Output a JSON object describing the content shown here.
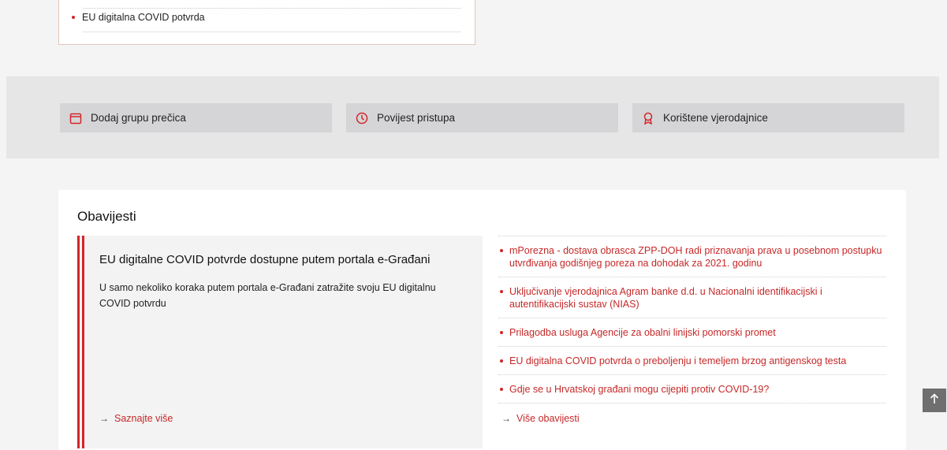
{
  "top_card": {
    "item": "EU digitalna COVID potvrda"
  },
  "quick_links": [
    {
      "label": "Dodaj grupu prečica",
      "icon": "calendar-icon"
    },
    {
      "label": "Povijest pristupa",
      "icon": "clock-icon"
    },
    {
      "label": "Korištene vjerodajnice",
      "icon": "award-icon"
    }
  ],
  "notices": {
    "title": "Obavijesti",
    "featured": {
      "headline": "EU digitalne COVID potvrde dostupne putem portala e-Građani",
      "body": "U samo nekoliko koraka putem portala e-Građani zatražite svoju EU digitalnu COVID potvrdu",
      "link": "Saznajte više"
    },
    "items": [
      "mPorezna - dostava obrasca ZPP-DOH radi priznavanja prava u posebnom postupku utvrđivanja godišnjeg poreza na dohodak za 2021. godinu",
      "Uključivanje vjerodajnica Agram banke d.d. u Nacionalni identifikacijski i autentifikacijski sustav (NIAS)",
      "Prilagodba usluga Agencije za obalni linijski pomorski promet",
      "EU digitalna COVID potvrda o preboljenju i temeljem brzog antigenskog testa",
      "Gdje se u Hrvatskoj građani mogu cijepiti protiv COVID-19?"
    ],
    "more_link": "Više obavijesti"
  },
  "colors": {
    "accent": "#d3262a",
    "link": "#c62828",
    "band": "#e6e6e6",
    "button": "#d5d5d7"
  },
  "back_to_top_icon": "arrow-up-icon"
}
